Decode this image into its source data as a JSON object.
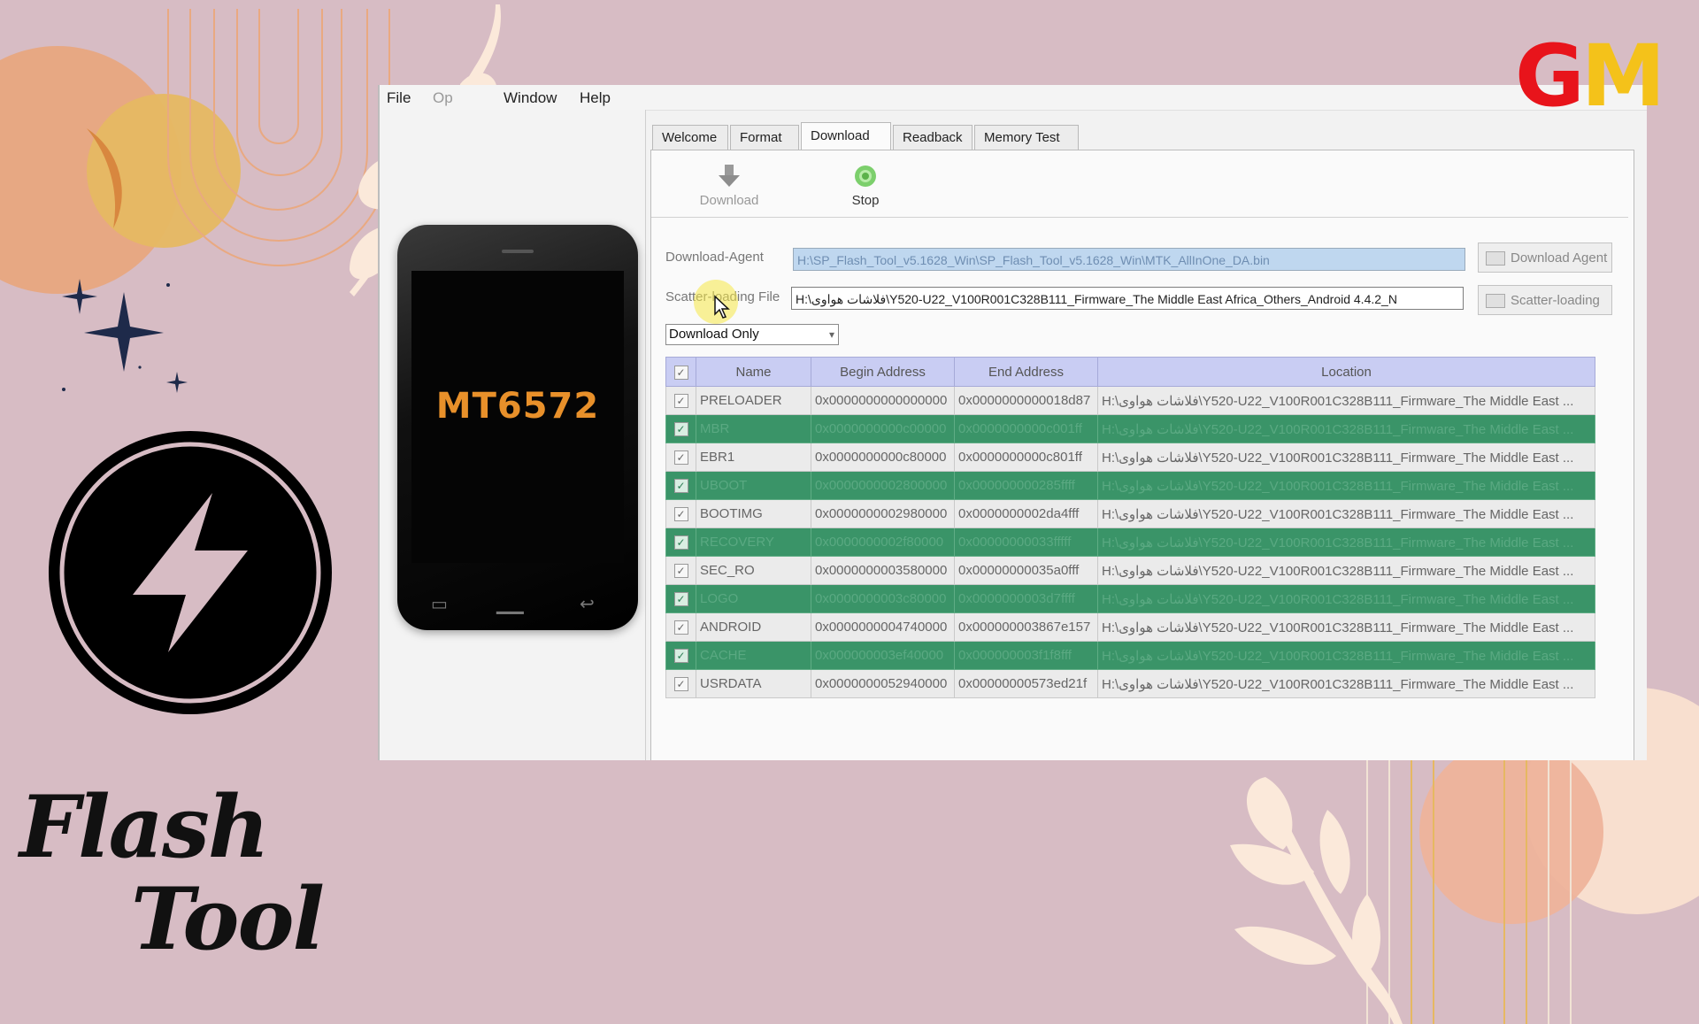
{
  "menu": {
    "file": "File",
    "edit": "Op",
    "window": "Window",
    "help": "Help"
  },
  "phone": {
    "chip": "MT6572"
  },
  "tabs": [
    {
      "label": "Welcome"
    },
    {
      "label": "Format"
    },
    {
      "label": "Download",
      "active": true
    },
    {
      "label": "Readback"
    },
    {
      "label": "Memory Test"
    }
  ],
  "toolbar": {
    "download": "Download",
    "stop": "Stop"
  },
  "form": {
    "download_agent_label": "Download-Agent",
    "download_agent_value": "H:\\SP_Flash_Tool_v5.1628_Win\\SP_Flash_Tool_v5.1628_Win\\MTK_AllInOne_DA.bin",
    "download_agent_button": "Download Agent",
    "scatter_label": "Scatter-loading File",
    "scatter_value": "H:\\فلاشات هواوى\\Y520-U22_V100R001C328B111_Firmware_The Middle East Africa_Others_Android 4.4.2_N",
    "scatter_button": "Scatter-loading",
    "mode": "Download Only"
  },
  "table": {
    "headers": {
      "name": "Name",
      "begin": "Begin Address",
      "end": "End Address",
      "location": "Location"
    },
    "rows": [
      {
        "name": "PRELOADER",
        "begin": "0x0000000000000000",
        "end": "0x0000000000018d87",
        "location": "H:\\فلاشات هواوى\\Y520-U22_V100R001C328B111_Firmware_The Middle East ..."
      },
      {
        "name": "MBR",
        "begin": "0x0000000000c00000",
        "end": "0x0000000000c001ff",
        "location": "H:\\فلاشات هواوى\\Y520-U22_V100R001C328B111_Firmware_The Middle East ..."
      },
      {
        "name": "EBR1",
        "begin": "0x0000000000c80000",
        "end": "0x0000000000c801ff",
        "location": "H:\\فلاشات هواوى\\Y520-U22_V100R001C328B111_Firmware_The Middle East ..."
      },
      {
        "name": "UBOOT",
        "begin": "0x0000000002800000",
        "end": "0x000000000285ffff",
        "location": "H:\\فلاشات هواوى\\Y520-U22_V100R001C328B111_Firmware_The Middle East ..."
      },
      {
        "name": "BOOTIMG",
        "begin": "0x0000000002980000",
        "end": "0x0000000002da4fff",
        "location": "H:\\فلاشات هواوى\\Y520-U22_V100R001C328B111_Firmware_The Middle East ..."
      },
      {
        "name": "RECOVERY",
        "begin": "0x0000000002f80000",
        "end": "0x00000000033fffff",
        "location": "H:\\فلاشات هواوى\\Y520-U22_V100R001C328B111_Firmware_The Middle East ..."
      },
      {
        "name": "SEC_RO",
        "begin": "0x0000000003580000",
        "end": "0x00000000035a0fff",
        "location": "H:\\فلاشات هواوى\\Y520-U22_V100R001C328B111_Firmware_The Middle East ..."
      },
      {
        "name": "LOGO",
        "begin": "0x0000000003c80000",
        "end": "0x0000000003d7ffff",
        "location": "H:\\فلاشات هواوى\\Y520-U22_V100R001C328B111_Firmware_The Middle East ..."
      },
      {
        "name": "ANDROID",
        "begin": "0x0000000004740000",
        "end": "0x000000003867e157",
        "location": "H:\\فلاشات هواوى\\Y520-U22_V100R001C328B111_Firmware_The Middle East ..."
      },
      {
        "name": "CACHE",
        "begin": "0x000000003ef40000",
        "end": "0x000000003f1f8fff",
        "location": "H:\\فلاشات هواوى\\Y520-U22_V100R001C328B111_Firmware_The Middle East ..."
      },
      {
        "name": "USRDATA",
        "begin": "0x0000000052940000",
        "end": "0x00000000573ed21f",
        "location": "H:\\فلاشات هواوى\\Y520-U22_V100R001C328B111_Firmware_The Middle East ..."
      }
    ]
  },
  "branding": {
    "title_line1": "Flash",
    "title_line2": "Tool",
    "logo_g": "G",
    "logo_m": "M",
    "logo_g_color": "#e8141b",
    "logo_m_color": "#f4c21a",
    "icon": "lightning-bolt-icon"
  },
  "colors": {
    "background": "#d7bcc4",
    "row_highlight": "#3a9468",
    "header": "#c9cdf3"
  }
}
